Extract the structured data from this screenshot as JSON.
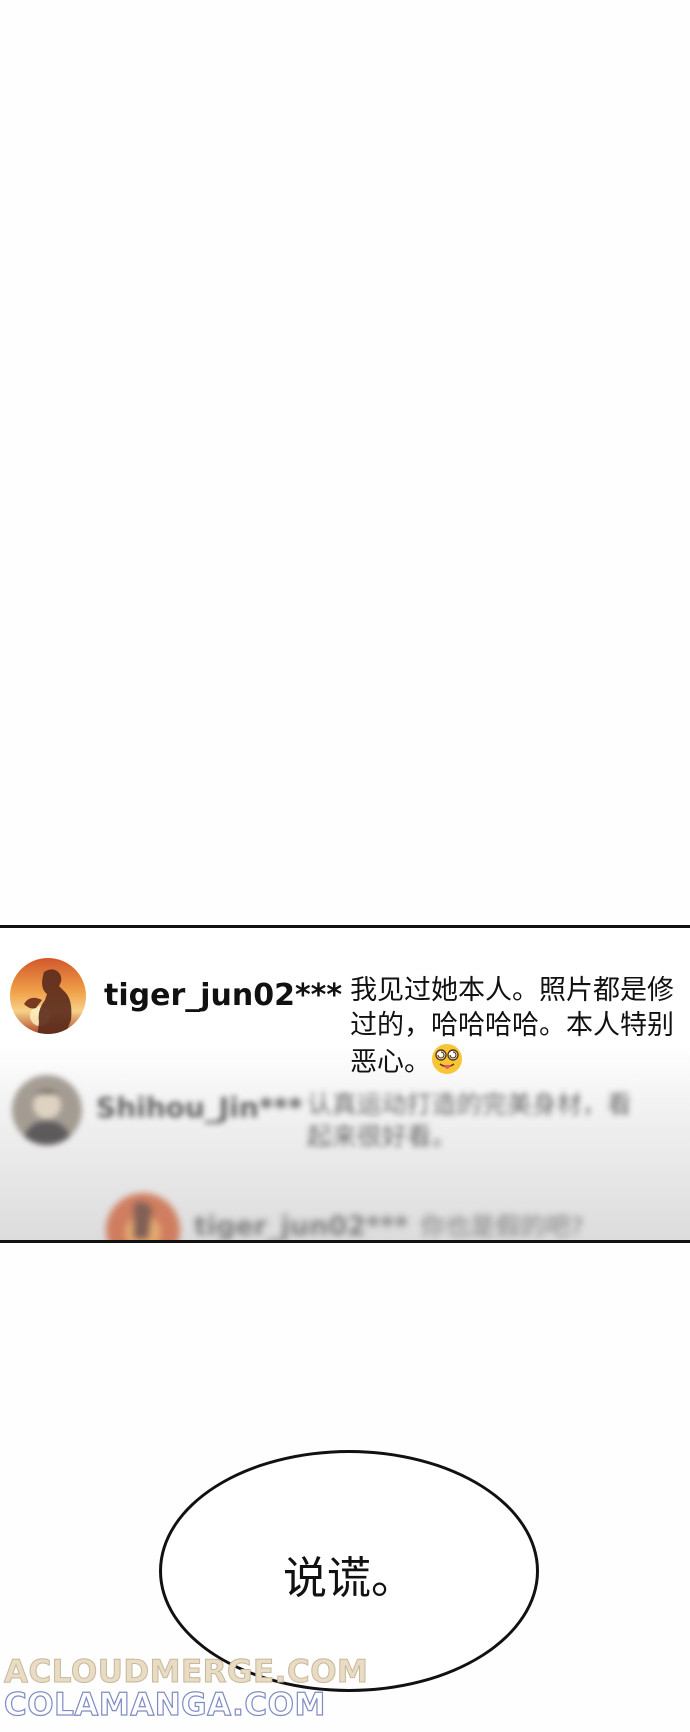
{
  "comments": [
    {
      "username": "tiger_jun02***",
      "text": "我见过她本人。照片都是修过的，哈哈哈哈。本人特别恶心。",
      "emoji": "woozy-tongue-emoji"
    },
    {
      "username": "Shihou_Jin***",
      "text": "认真运动打造的完美身材，看起来很好看。"
    },
    {
      "username": "tiger_jun02***",
      "text": "你也是假的吧?"
    }
  ],
  "speech_bubble": {
    "text": "说谎。"
  },
  "watermark": {
    "line_1": "ACLOUDMERGE.COM",
    "line_2": "COLAMANGA.COM"
  },
  "colors": {
    "panel_border": "#111111",
    "watermark_1": "#e9dcc4",
    "watermark_2_outline": "#7f8cc4"
  }
}
